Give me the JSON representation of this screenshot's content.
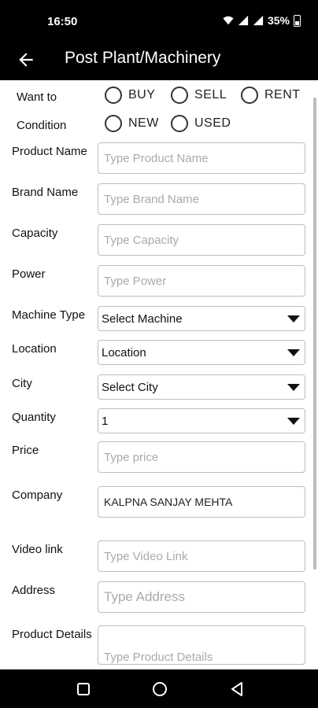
{
  "status": {
    "time": "16:50",
    "battery": "35%"
  },
  "appbar": {
    "title": "Post Plant/Machinery"
  },
  "form": {
    "want_to": {
      "label": "Want to",
      "options": [
        "BUY",
        "SELL",
        "RENT"
      ]
    },
    "condition": {
      "label": "Condition",
      "options": [
        "NEW",
        "USED"
      ]
    },
    "product_name": {
      "label": "Product Name",
      "placeholder": "Type Product Name"
    },
    "brand_name": {
      "label": "Brand Name",
      "placeholder": "Type Brand Name"
    },
    "capacity": {
      "label": "Capacity",
      "placeholder": "Type Capacity"
    },
    "power": {
      "label": "Power",
      "placeholder": "Type Power"
    },
    "machine_type": {
      "label": "Machine Type",
      "value": "Select Machine"
    },
    "location": {
      "label": "Location",
      "value": "Location"
    },
    "city": {
      "label": "City",
      "value": "Select City"
    },
    "quantity": {
      "label": "Quantity",
      "value": "1"
    },
    "price": {
      "label": "Price",
      "placeholder": "Type price"
    },
    "company": {
      "label": "Company",
      "value": "KALPNA SANJAY MEHTA"
    },
    "video_link": {
      "label": "Video link",
      "placeholder": "Type Video Link"
    },
    "address": {
      "label": "Address",
      "placeholder": "Type Address"
    },
    "product_details": {
      "label": "Product Details",
      "placeholder": "Type Product Details"
    }
  }
}
